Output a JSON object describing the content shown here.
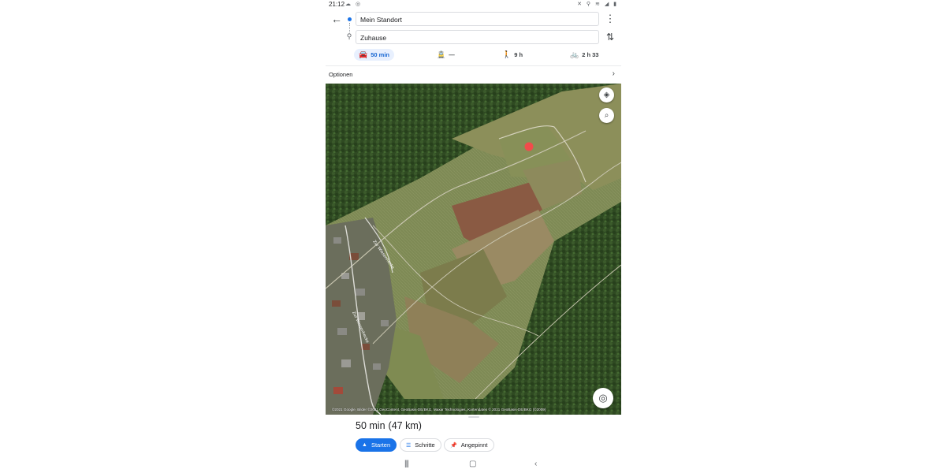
{
  "status_bar": {
    "time": "21:12",
    "left_icons": "☁ ◎",
    "right_icons": "✕ ⚲ ≋ ◢ ▮"
  },
  "route": {
    "origin": "Mein Standort",
    "destination": "Zuhause"
  },
  "modes": [
    {
      "icon": "car-icon",
      "glyph": "🚘",
      "label": "50 min",
      "active": true
    },
    {
      "icon": "transit-icon",
      "glyph": "🚊",
      "label": "—",
      "active": false
    },
    {
      "icon": "walk-icon",
      "glyph": "🚶",
      "label": "9 h",
      "active": false
    },
    {
      "icon": "bike-icon",
      "glyph": "🚲",
      "label": "2 h 33",
      "active": false
    }
  ],
  "options": {
    "label": "Optionen"
  },
  "map": {
    "attribution": "©2021 Google, Bilder ©2021 GeoContent, GeoBasis-DE/BKG, Maxar Technologies, Kartendaten © 2021 GeoBasis-DE/BKG (©2009)",
    "street_label_1": "Zur Wiesenhecke",
    "street_label_2": "Zur Wiesenhecke",
    "marker_color": "#f24b4b"
  },
  "summary": {
    "duration": "50 min",
    "distance": "(47 km)"
  },
  "actions": {
    "start": "Starten",
    "steps": "Schritte",
    "pinned": "Angepinnt"
  },
  "colors": {
    "accent": "#1a73e8",
    "active_chip_bg": "#e8f0fe"
  }
}
